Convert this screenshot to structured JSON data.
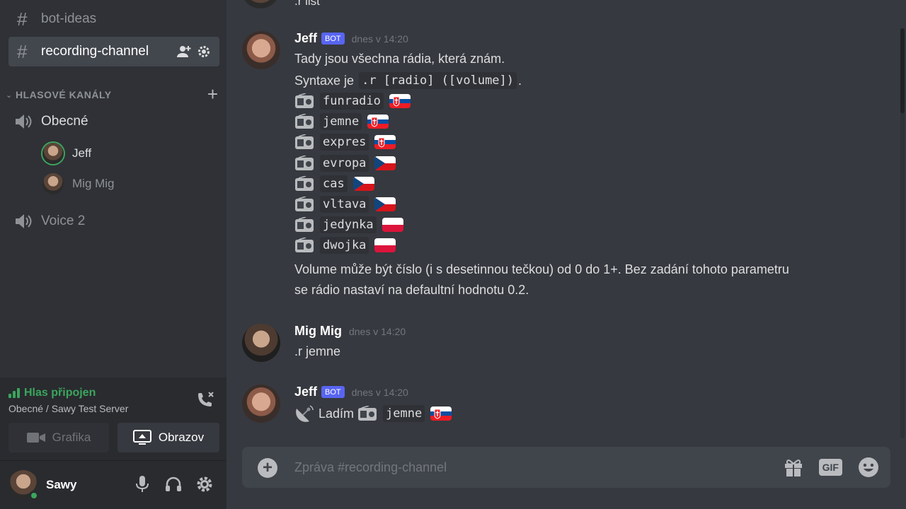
{
  "sidebar": {
    "channels": [
      {
        "label": "bot-ideas"
      },
      {
        "label": "recording-channel"
      }
    ],
    "category": {
      "label": "HLASOVÉ KANÁLY"
    },
    "voice_channels": [
      {
        "label": "Obecné"
      },
      {
        "label": "Voice 2"
      }
    ],
    "voice_users": [
      {
        "label": "Jeff"
      },
      {
        "label": "Mig Mig"
      }
    ]
  },
  "voice_connection": {
    "title": "Hlas připojen",
    "subtitle": "Obecné / Sawy Test Server",
    "video_label": "Grafika",
    "screen_label": "Obrazov"
  },
  "user_panel": {
    "name": "Sawy"
  },
  "chat": {
    "previous_line": ".r list",
    "messages": [
      {
        "author": "Jeff",
        "badge": "BOT",
        "time": "dnes v 14:20",
        "intro": "Tady jsou všechna rádia, která znám.",
        "syntax_prefix": "Syntaxe je",
        "syntax_code": ".r [radio] ([volume])",
        "syntax_suffix": ".",
        "radios": [
          {
            "name": "funradio",
            "flag": "sk"
          },
          {
            "name": "jemne",
            "flag": "sk"
          },
          {
            "name": "expres",
            "flag": "sk"
          },
          {
            "name": "evropa",
            "flag": "cz"
          },
          {
            "name": "cas",
            "flag": "cz"
          },
          {
            "name": "vltava",
            "flag": "cz"
          },
          {
            "name": "jedynka",
            "flag": "pl"
          },
          {
            "name": "dwojka",
            "flag": "pl"
          }
        ],
        "outro_1": "Volume může být číslo (i s desetinnou tečkou) od 0 do 1+. Bez zadání tohoto parametru",
        "outro_2": "se rádio nastaví na defaultní hodnotu 0.2."
      },
      {
        "author": "Mig Mig",
        "time": "dnes v 14:20",
        "text": ".r jemne"
      },
      {
        "author": "Jeff",
        "badge": "BOT",
        "time": "dnes v 14:20",
        "prefix": "Ladím",
        "radio": "jemne",
        "flag": "sk"
      }
    ]
  },
  "composer": {
    "placeholder": "Zpráva #recording-channel",
    "gif_label": "GIF"
  },
  "colors": {
    "accent": "#5865f2",
    "online": "#3ba55d",
    "background": "#36393f",
    "sidebar": "#2f3136"
  }
}
